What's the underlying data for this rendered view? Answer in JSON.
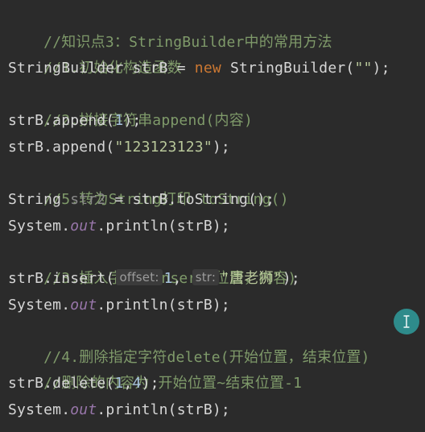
{
  "code": {
    "line1_comment": "//知识点3：StringBuilder中的常用方法",
    "line2_comment": "//1.初始化构造函数",
    "line3": {
      "type": "StringBuilder",
      "var": " strB = ",
      "kw_new": "new",
      "ctor": " StringBuilder(",
      "str": "\"\"",
      "end": ");"
    },
    "line4_comment": "//2.拼接字符串append(内容)",
    "line5": {
      "pre": "strB.append(",
      "num": "1",
      "end": ");"
    },
    "line6": {
      "pre": "strB.append(",
      "str": "\"123123123\"",
      "end": ");"
    },
    "line7_comment": "//5.转为String打印 toString()",
    "line8": {
      "type": "String ",
      "var": "str2",
      "rest": " = strB.toString();"
    },
    "line9": {
      "pre": "System.",
      "field": "out",
      "post": ".println(strB);"
    },
    "line10_comment": "//3.插入字符串insert(位置，内容)",
    "line11": {
      "pre": "strB.insert(",
      "hint_offset": "offset:",
      "num": "1",
      "comma": ", ",
      "hint_str": "str:",
      "str": "\"唐老狮\"",
      "end": ");"
    },
    "line12": {
      "pre": "System.",
      "field": "out",
      "post": ".println(strB);"
    },
    "line13_comment": "//4.删除指定字符delete(开始位置，结束位置)",
    "line14_comment": "//删除的内容为 开始位置~结束位置-1",
    "line15": {
      "pre": "strB.delete(",
      "num1": "1",
      "comma": ",",
      "num2": "4",
      "end": ");"
    },
    "line16": {
      "pre": "System.",
      "field": "out",
      "post": ".println(strB);"
    }
  },
  "cursor_icon": "text-cursor-icon",
  "colors": {
    "background": "#2b2b2b",
    "comment": "#7f9a6a",
    "keyword": "#cc7832",
    "string": "#b8c79a",
    "number": "#a6c2dd",
    "field": "#9876aa"
  }
}
